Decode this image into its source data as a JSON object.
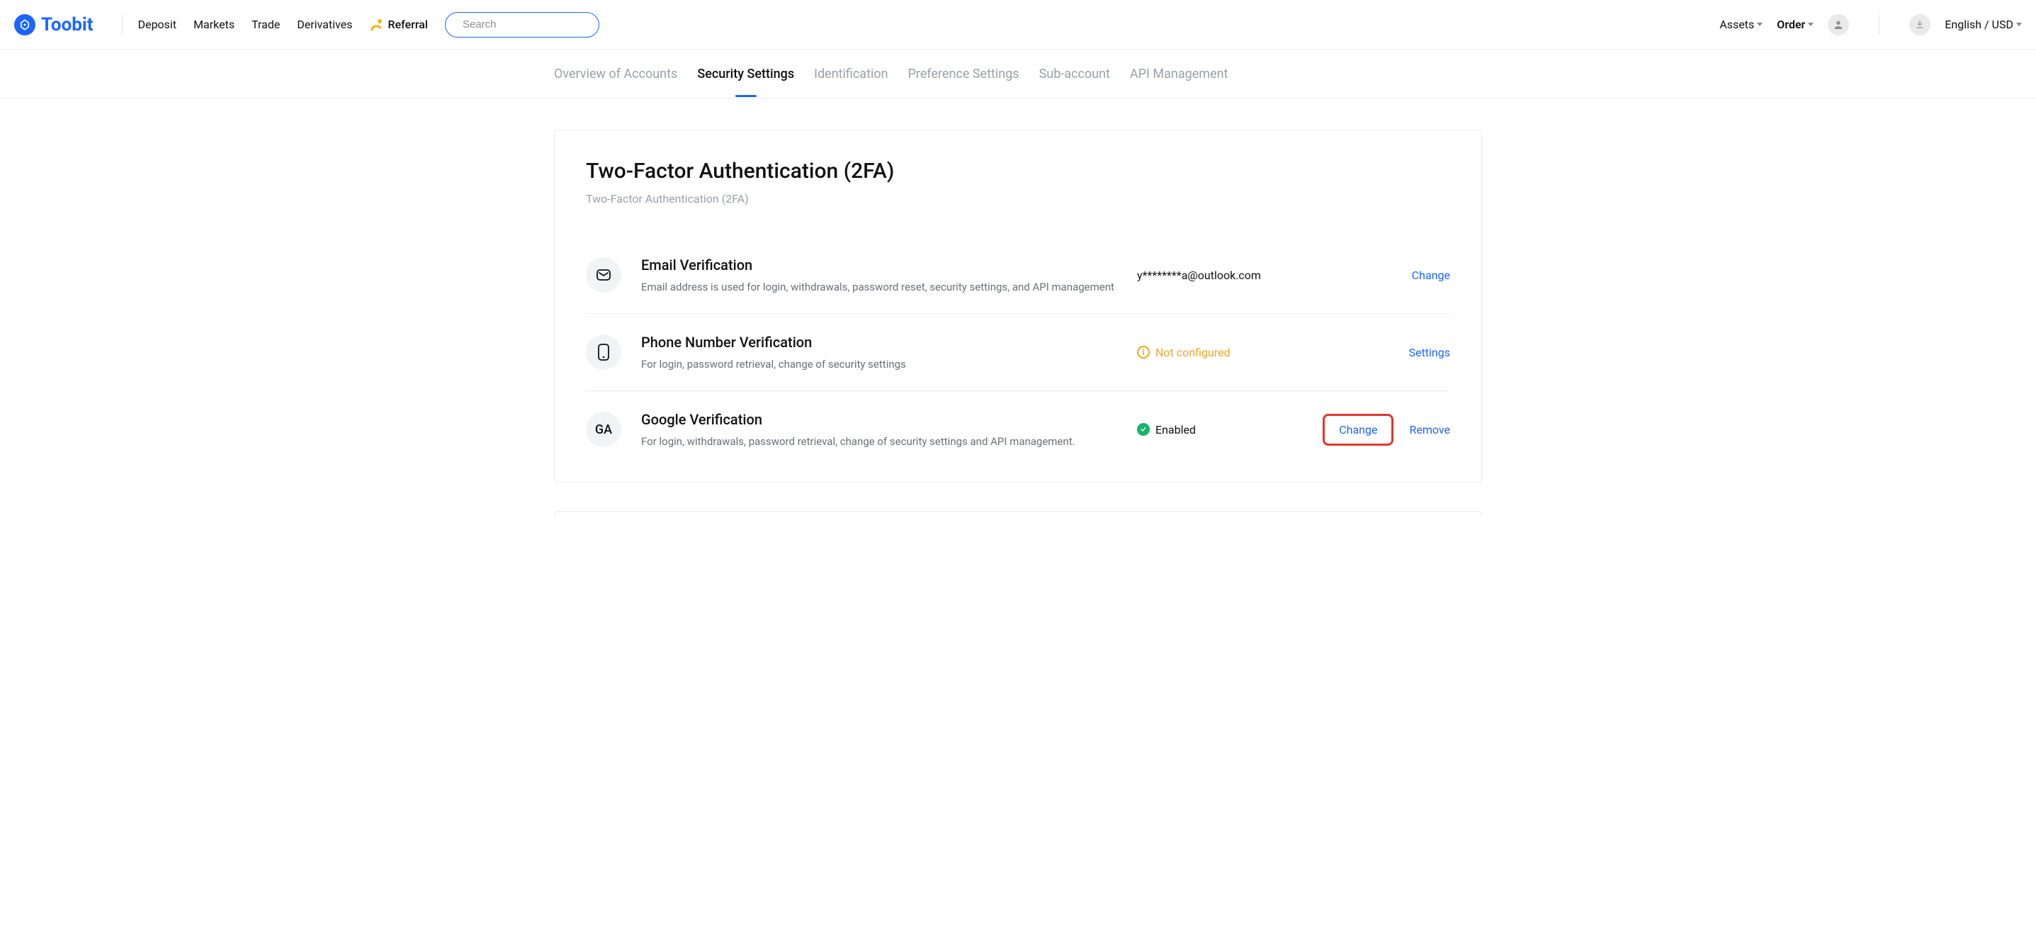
{
  "brand": {
    "name": "Toobit"
  },
  "nav": {
    "deposit": "Deposit",
    "markets": "Markets",
    "trade": "Trade",
    "derivatives": "Derivatives",
    "referral": "Referral"
  },
  "search": {
    "placeholder": "Search"
  },
  "topright": {
    "assets": "Assets",
    "order": "Order",
    "locale": "English / USD"
  },
  "tabs": {
    "overview": "Overview of Accounts",
    "security": "Security Settings",
    "identification": "Identification",
    "preference": "Preference Settings",
    "subaccount": "Sub-account",
    "api": "API Management"
  },
  "card": {
    "title": "Two-Factor Authentication (2FA)",
    "subtitle": "Two-Factor Authentication (2FA)"
  },
  "rows": {
    "email": {
      "title": "Email Verification",
      "desc": "Email address is used for login, withdrawals, password reset, security settings, and API management",
      "status": "y********a@outlook.com",
      "action": "Change"
    },
    "phone": {
      "title": "Phone Number Verification",
      "desc": "For login, password retrieval, change of security settings",
      "status": "Not configured",
      "action": "Settings"
    },
    "google": {
      "title": "Google Verification",
      "desc": "For login, withdrawals, password retrieval, change of security settings and API management.",
      "status": "Enabled",
      "action_change": "Change",
      "action_remove": "Remove",
      "ga_badge": "GA"
    }
  }
}
